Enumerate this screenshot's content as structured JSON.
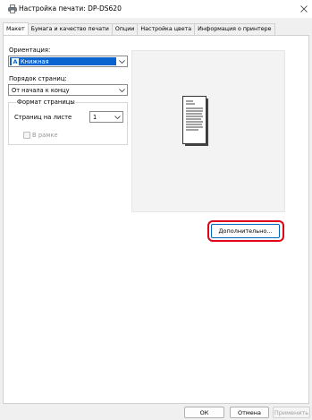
{
  "window": {
    "title": "Настройка печати: DP-DS620"
  },
  "tabs": [
    {
      "label": "Макет",
      "active": true
    },
    {
      "label": "Бумага и качество печати",
      "active": false
    },
    {
      "label": "Опции",
      "active": false
    },
    {
      "label": "Настройка цвета",
      "active": false
    },
    {
      "label": "Информация о принтере",
      "active": false
    }
  ],
  "layout": {
    "orientation_label": "Ориентация:",
    "orientation_value": "Книжная",
    "page_order_label": "Порядок страниц:",
    "page_order_value": "От начала к концу",
    "page_format_group": "Формат страницы",
    "pages_per_sheet_label": "Страниц на листе",
    "pages_per_sheet_value": "1",
    "border_label": "В рамке",
    "border_checked": false
  },
  "buttons": {
    "advanced": "Дополнительно...",
    "ok": "ОК",
    "cancel": "Отмена",
    "apply": "Применить"
  },
  "colors": {
    "accent": "#0067c0",
    "selection": "#0a64d0",
    "highlight": "#e00018"
  }
}
